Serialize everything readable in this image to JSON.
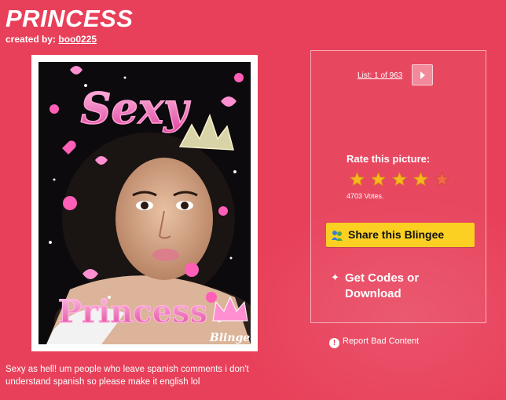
{
  "header": {
    "title": "PRINCESS",
    "created_by_label": "created by:",
    "creator_name": "boo0225"
  },
  "image": {
    "top_word": "Sexy",
    "bottom_word": "Princess",
    "watermark": "Blingee"
  },
  "sidebar": {
    "list_label": "List: 1 of 963",
    "rate_title": "Rate this picture:",
    "rating": 4,
    "votes": "4703 Votes.",
    "share_label": "Share this Blingee",
    "codes_label": "Get Codes or Download"
  },
  "footer": {
    "report_label": "Report Bad Content",
    "description": "Sexy as hell! um people who leave spanish comments i don't understand spanish so please make it english lol"
  },
  "colors": {
    "background": "#e8405a",
    "share_button": "#fcd022",
    "star_active": "#f5b81f",
    "star_last": "#f26a4a"
  }
}
